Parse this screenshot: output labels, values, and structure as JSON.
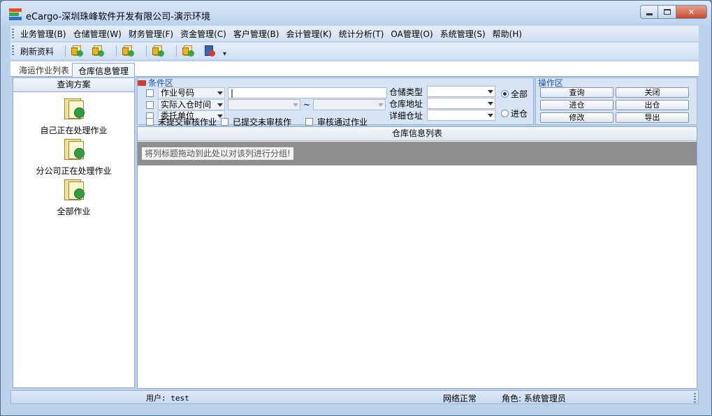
{
  "window": {
    "title": "eCargo-深圳珠峰软件开发有限公司-演示环境",
    "controls": {
      "minimize": "minimize-icon",
      "maximize": "maximize-icon",
      "close": "close-icon",
      "close_glyph": "✕"
    }
  },
  "menu": [
    "业务管理(B)",
    "仓储管理(W)",
    "财务管理(F)",
    "资金管理(C)",
    "客户管理(B)",
    "会计管理(K)",
    "统计分析(T)",
    "OA管理(O)",
    "系统管理(S)",
    "帮助(H)"
  ],
  "toolbar": {
    "refresh_label": "刷新资料",
    "icons": [
      "document-gold-icon",
      "document-gold-icon",
      "document-gold-icon",
      "document-gold-icon",
      "document-gold-icon",
      "exit-door-icon"
    ],
    "more_glyph": "▾"
  },
  "tabs": [
    {
      "label": "海运作业列表",
      "active": false
    },
    {
      "label": "仓库信息管理",
      "active": true
    }
  ],
  "query_panel": {
    "header": "查询方案",
    "schemes": [
      "自己正在处理作业",
      "分公司正在处理作业",
      "全部作业"
    ]
  },
  "conditions": {
    "title": "条件区",
    "field1_label": "作业号码",
    "field1_value": "|",
    "field2_label": "实际入仓时间",
    "range_separator": "~",
    "field3_label": "委托单位",
    "checkbox_labels": [
      "未提交审核作业",
      "已提交未审核作",
      "审核通过作业"
    ],
    "storage_type_label": "仓储类型",
    "warehouse_address_label": "仓库地址",
    "detail_location_label": "详细仓址",
    "radio_all": "全部",
    "radio_in": "进仓",
    "radio_selected": "all"
  },
  "operations": {
    "title": "操作区",
    "buttons": [
      "查询",
      "关闭",
      "进仓",
      "出仓",
      "修改",
      "导出"
    ]
  },
  "grid": {
    "header": "仓库信息列表",
    "group_hint": "将列标题拖动到此处以对该列进行分组!"
  },
  "status": {
    "user": "用户: test",
    "network": "网络正常",
    "role": "角色: 系统管理员"
  }
}
